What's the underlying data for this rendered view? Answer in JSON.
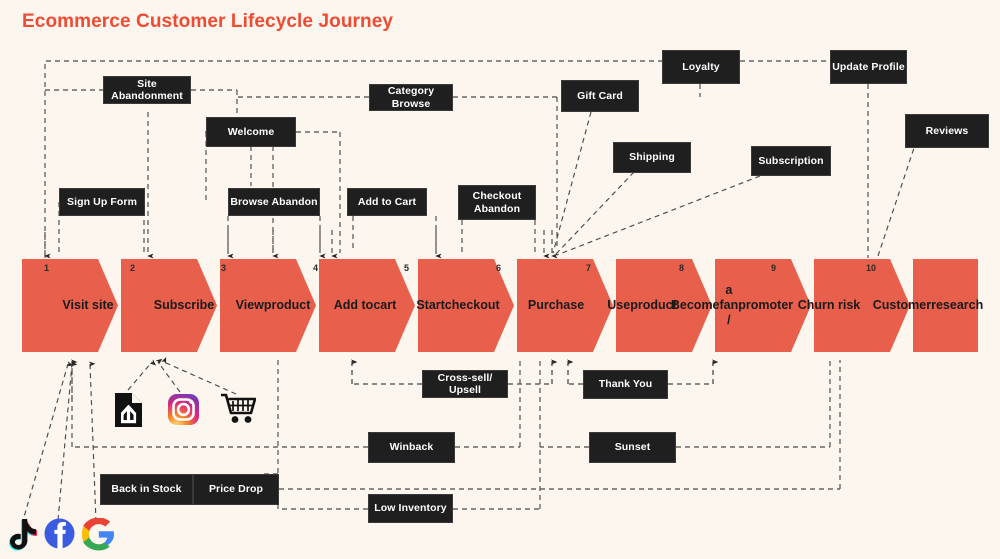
{
  "title": "Ecommerce Customer Lifecycle Journey",
  "colors": {
    "background": "#fcf6ee",
    "title": "#ee4b33",
    "chevron": "#e8604c",
    "node_fill": "#1f1f1f",
    "node_text": "#ffffff",
    "wire": "#4a4a4a"
  },
  "journey": {
    "stages": [
      {
        "num": "1",
        "label": "Visit site"
      },
      {
        "num": "2",
        "label": "Subscribe"
      },
      {
        "num": "3",
        "label": "View\nproduct"
      },
      {
        "num": "4",
        "label": "Add to\ncart"
      },
      {
        "num": "5",
        "label": "Start\ncheckout"
      },
      {
        "num": "6",
        "label": "Purchase"
      },
      {
        "num": "7",
        "label": "Use\nproduct"
      },
      {
        "num": "8",
        "label": "Become\na fan /\npromoter"
      },
      {
        "num": "9",
        "label": "Churn risk"
      },
      {
        "num": "10",
        "label": "Customer\nresearch"
      }
    ]
  },
  "touchpoints_above": [
    {
      "label": "Site Abandonment"
    },
    {
      "label": "Category Browse"
    },
    {
      "label": "Loyalty"
    },
    {
      "label": "Update  Profile"
    },
    {
      "label": "Welcome"
    },
    {
      "label": "Gift Card"
    },
    {
      "label": "Shipping"
    },
    {
      "label": "Subscription"
    },
    {
      "label": "Reviews"
    },
    {
      "label": "Sign Up   Form"
    },
    {
      "label": "Browse Abandon"
    },
    {
      "label": "Add to Cart"
    },
    {
      "label": "Checkout\nAbandon"
    }
  ],
  "touchpoints_below": [
    {
      "label": "Cross-sell/ Upsell"
    },
    {
      "label": "Thank You"
    },
    {
      "label": "Winback"
    },
    {
      "label": "Sunset"
    },
    {
      "label": "Back in Stock"
    },
    {
      "label": "Price Drop"
    },
    {
      "label": "Low Inventory"
    }
  ],
  "channel_icons": [
    {
      "name": "share-file-icon"
    },
    {
      "name": "instagram-icon"
    },
    {
      "name": "shopping-cart-icon"
    },
    {
      "name": "tiktok-icon"
    },
    {
      "name": "facebook-icon"
    },
    {
      "name": "google-icon"
    }
  ]
}
